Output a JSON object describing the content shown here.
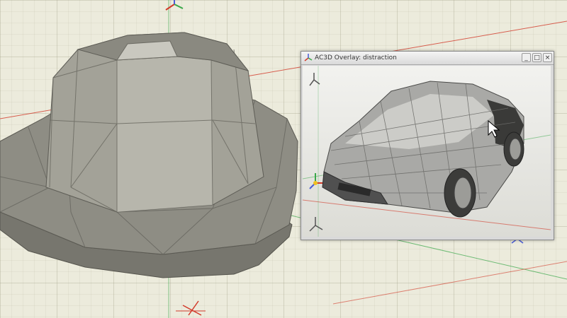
{
  "main_viewport": {
    "model": "hat-mesh-model",
    "ground_grid": "visible"
  },
  "preview_window": {
    "title": "AC3D Overlay: distraction",
    "buttons": {
      "minimize": "_",
      "maximize": "□",
      "close": "×"
    },
    "model": "car-mesh-model"
  },
  "colors": {
    "background": "#ecebdc",
    "grid": "#c8c7b0",
    "axis_red": "#d23a2a",
    "axis_green": "#3aa84a",
    "axis_blue": "#4a5cd6",
    "mesh_gray": "#8e8d84"
  }
}
